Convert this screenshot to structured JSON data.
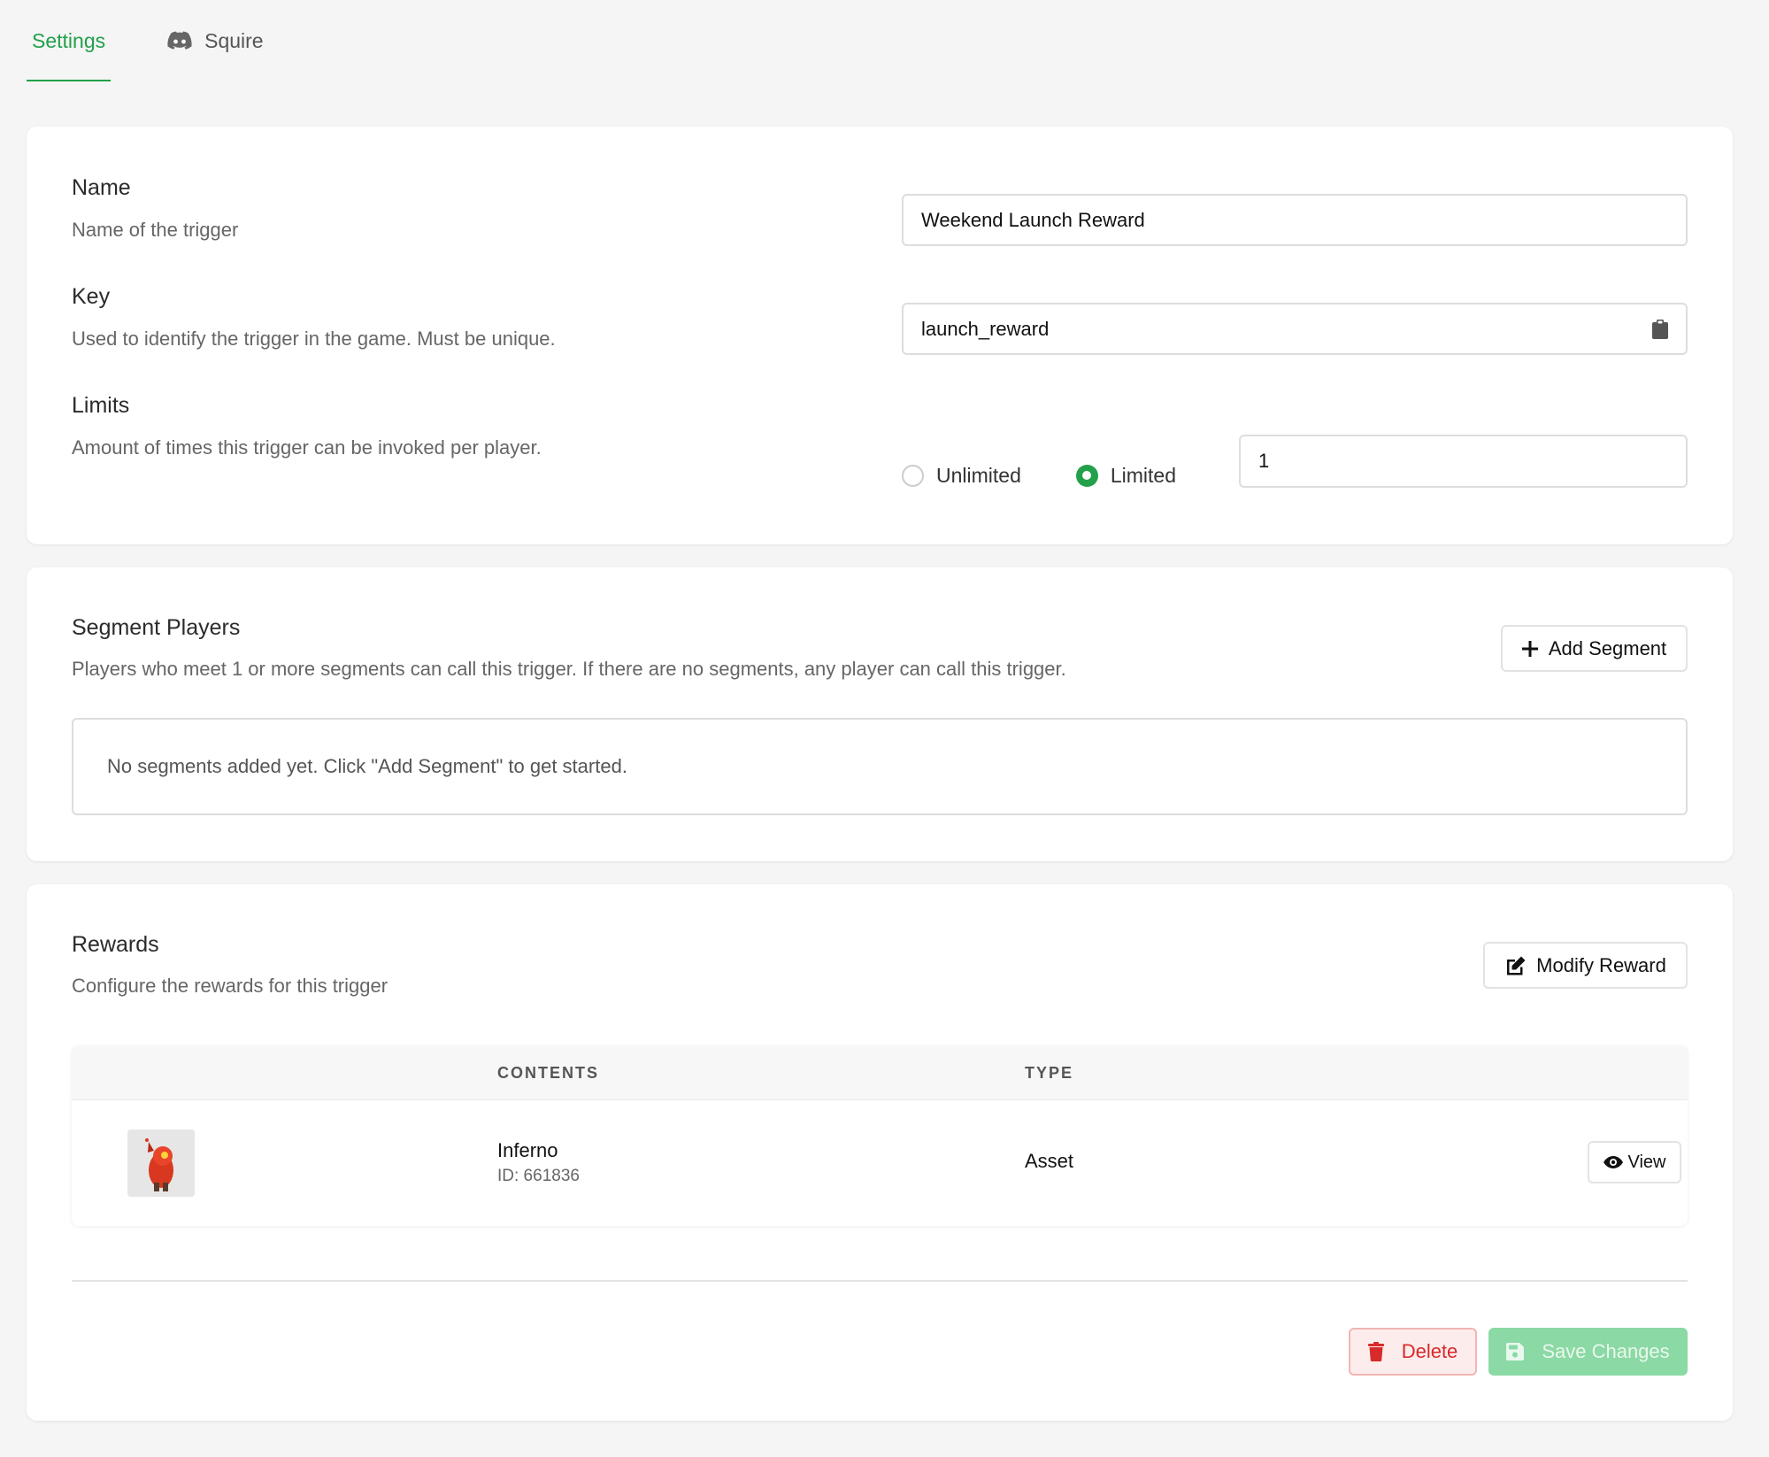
{
  "tabs": {
    "settings": "Settings",
    "squire": "Squire"
  },
  "name_section": {
    "label": "Name",
    "description": "Name of the trigger",
    "value": "Weekend Launch Reward"
  },
  "key_section": {
    "label": "Key",
    "description": "Used to identify the trigger in the game. Must be unique.",
    "value": "launch_reward"
  },
  "limits_section": {
    "label": "Limits",
    "description": "Amount of times this trigger can be invoked per player.",
    "options": [
      "Unlimited",
      "Limited"
    ],
    "selected": "Limited",
    "value": "1"
  },
  "segments": {
    "title": "Segment Players",
    "description": "Players who meet 1 or more segments can call this trigger. If there are no segments, any player can call this trigger.",
    "add_button": "Add Segment",
    "empty_text": "No segments added yet. Click \"Add Segment\" to get started."
  },
  "rewards": {
    "title": "Rewards",
    "description": "Configure the rewards for this trigger",
    "modify_button": "Modify Reward",
    "columns": [
      "CONTENTS",
      "TYPE"
    ],
    "rows": [
      {
        "name": "Inferno",
        "id": "ID: 661836",
        "type": "Asset",
        "action": "View"
      }
    ]
  },
  "footer": {
    "delete_label": "Delete",
    "save_label": "Save Changes"
  },
  "colors": {
    "accent": "#22a04a",
    "danger": "#d72a2a",
    "save_disabled": "#8bd9a4"
  }
}
